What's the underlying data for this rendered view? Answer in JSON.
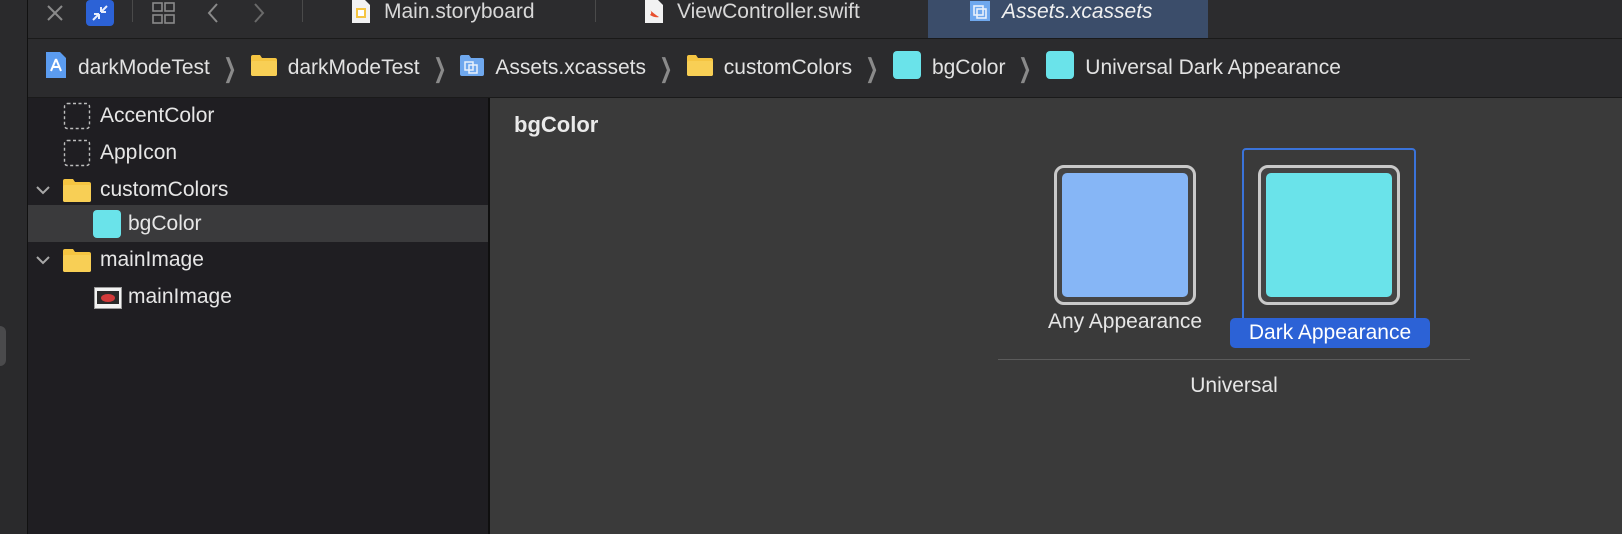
{
  "tabs": [
    {
      "label": "Main.storyboard",
      "icon": "storyboard-file-icon"
    },
    {
      "label": "ViewController.swift",
      "icon": "swift-file-icon"
    },
    {
      "label": "Assets.xcassets",
      "icon": "asset-catalog-icon",
      "active": true
    }
  ],
  "breadcrumb": [
    {
      "label": "darkModeTest",
      "icon": "project-icon"
    },
    {
      "label": "darkModeTest",
      "icon": "folder-icon"
    },
    {
      "label": "Assets.xcassets",
      "icon": "asset-catalog-icon"
    },
    {
      "label": "customColors",
      "icon": "folder-icon"
    },
    {
      "label": "bgColor",
      "icon": "color-swatch-icon"
    },
    {
      "label": "Universal Dark Appearance",
      "icon": "color-swatch-icon"
    }
  ],
  "navigator": {
    "items": [
      {
        "label": "AccentColor"
      },
      {
        "label": "AppIcon"
      },
      {
        "label": "customColors"
      },
      {
        "label": "bgColor",
        "selected": true
      },
      {
        "label": "mainImage"
      },
      {
        "label": "mainImage"
      }
    ]
  },
  "editor": {
    "title": "bgColor",
    "wells": [
      {
        "label": "Any Appearance",
        "color": "#86b6f6"
      },
      {
        "label": "Dark Appearance",
        "color": "#6ae3ea",
        "selected": true
      }
    ],
    "group_label": "Universal"
  },
  "colors": {
    "accent": "#2c62d6",
    "folder": "#f5c542",
    "swatch_cyan": "#6ae3ea"
  }
}
